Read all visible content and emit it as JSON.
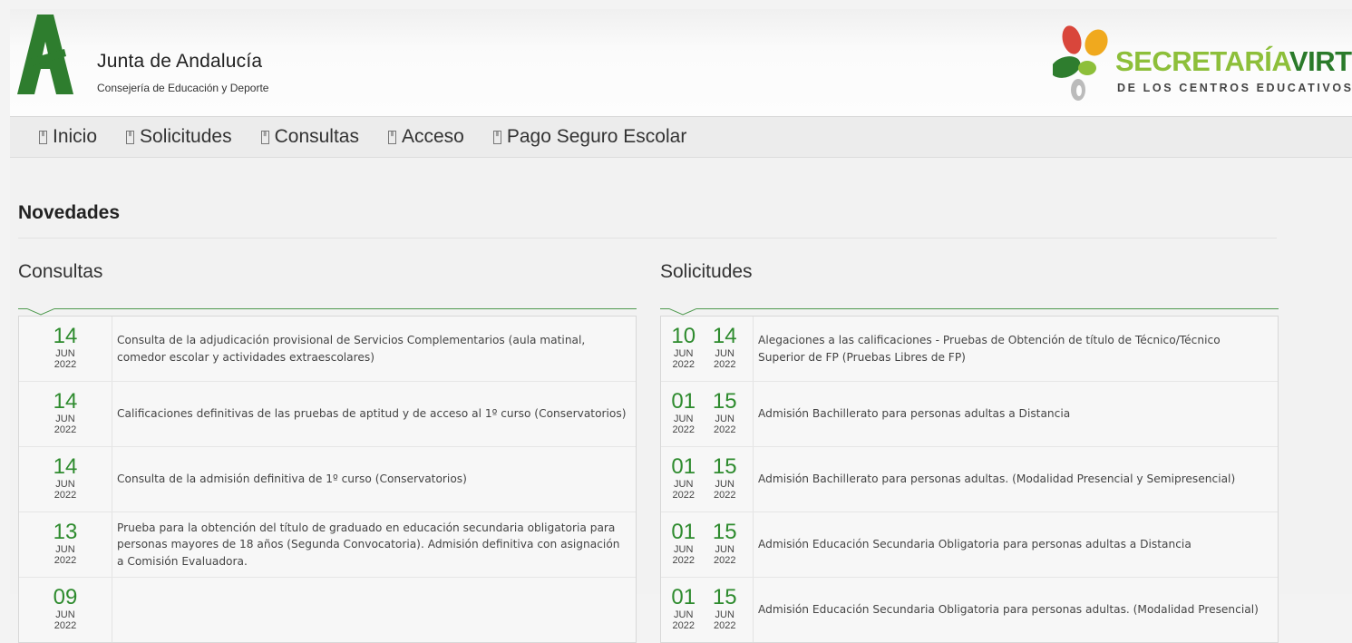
{
  "header": {
    "org_title": "Junta de Andalucía",
    "org_subtitle": "Consejería de Educación y Deporte",
    "app_title_part1": "SECRETARÍA",
    "app_title_part2": "VIRTUAL",
    "app_subtitle": "DE LOS CENTROS EDUCATIVOS",
    "colors": {
      "brand_green": "#2e7d2e",
      "light_green": "#8dbf3a",
      "red": "#d9463b",
      "orange": "#f0a91e"
    }
  },
  "nav": {
    "items": [
      {
        "label": "Inicio",
        "icon": "page-icon"
      },
      {
        "label": "Solicitudes",
        "icon": "page-icon"
      },
      {
        "label": "Consultas",
        "icon": "page-icon"
      },
      {
        "label": "Acceso",
        "icon": "page-icon"
      },
      {
        "label": "Pago Seguro Escolar",
        "icon": "page-icon"
      }
    ]
  },
  "main": {
    "title": "Novedades",
    "consultas": {
      "title": "Consultas",
      "items": [
        {
          "day": "14",
          "month": "JUN",
          "year": "2022",
          "text": "Consulta de la adjudicación provisional de Servicios Complementarios (aula matinal, comedor escolar y actividades extraescolares)"
        },
        {
          "day": "14",
          "month": "JUN",
          "year": "2022",
          "text": "Calificaciones definitivas de las pruebas de aptitud y de acceso al 1º curso (Conservatorios)"
        },
        {
          "day": "14",
          "month": "JUN",
          "year": "2022",
          "text": "Consulta de la admisión definitiva de 1º curso (Conservatorios)"
        },
        {
          "day": "13",
          "month": "JUN",
          "year": "2022",
          "text": "Prueba para la obtención del título de graduado en educación secundaria obligatoria para personas mayores de 18 años (Segunda Convocatoria). Admisión definitiva con asignación a Comisión Evaluadora."
        },
        {
          "day": "09",
          "month": "JUN",
          "year": "2022",
          "text": ""
        }
      ]
    },
    "solicitudes": {
      "title": "Solicitudes",
      "items": [
        {
          "start_day": "10",
          "start_month": "JUN",
          "start_year": "2022",
          "end_day": "14",
          "end_month": "JUN",
          "end_year": "2022",
          "text": "Alegaciones a las calificaciones - Pruebas de Obtención de título de Técnico/Técnico Superior de FP (Pruebas Libres de FP)"
        },
        {
          "start_day": "01",
          "start_month": "JUN",
          "start_year": "2022",
          "end_day": "15",
          "end_month": "JUN",
          "end_year": "2022",
          "text": "Admisión Bachillerato para personas adultas a Distancia"
        },
        {
          "start_day": "01",
          "start_month": "JUN",
          "start_year": "2022",
          "end_day": "15",
          "end_month": "JUN",
          "end_year": "2022",
          "text": "Admisión Bachillerato para personas adultas. (Modalidad Presencial y Semipresencial)"
        },
        {
          "start_day": "01",
          "start_month": "JUN",
          "start_year": "2022",
          "end_day": "15",
          "end_month": "JUN",
          "end_year": "2022",
          "text": "Admisión Educación Secundaria Obligatoria para personas adultas a Distancia"
        },
        {
          "start_day": "01",
          "start_month": "JUN",
          "start_year": "2022",
          "end_day": "15",
          "end_month": "JUN",
          "end_year": "2022",
          "text": "Admisión Educación Secundaria Obligatoria para personas adultas. (Modalidad Presencial)"
        }
      ]
    }
  }
}
